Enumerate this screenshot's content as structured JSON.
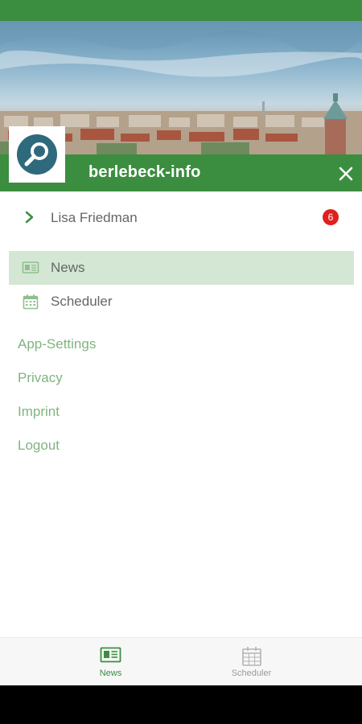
{
  "app": {
    "title": "berlebeck-info"
  },
  "user": {
    "name": "Lisa Friedman",
    "badge": "6"
  },
  "menu": {
    "items": [
      {
        "label": "News",
        "icon": "newspaper-icon",
        "active": true
      },
      {
        "label": "Scheduler",
        "icon": "calendar-icon",
        "active": false
      }
    ],
    "links": [
      "App-Settings",
      "Privacy",
      "Imprint",
      "Logout"
    ]
  },
  "bottom_nav": {
    "items": [
      {
        "label": "News",
        "icon": "newspaper-icon",
        "active": true
      },
      {
        "label": "Scheduler",
        "icon": "calendar-icon",
        "active": false
      }
    ]
  },
  "colors": {
    "primary": "#3b8e3f",
    "active_bg": "#d4e7d4",
    "link": "#7fb57f",
    "badge": "#e02020",
    "logo": "#2e6a7c"
  }
}
